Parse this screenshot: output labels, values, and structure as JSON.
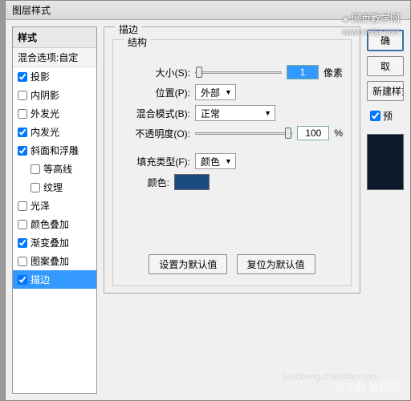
{
  "dialog_title": "图层样式",
  "watermark_top": "网页教学网",
  "watermark_top_url": "www.webjx.com",
  "watermark_bottom": "查字典 教程网",
  "watermark_bottom_url": "jiaocheng.chazidian.com",
  "left": {
    "header": "样式",
    "sub": "混合选项:自定",
    "items": [
      {
        "label": "投影",
        "checked": true
      },
      {
        "label": "内阴影",
        "checked": false
      },
      {
        "label": "外发光",
        "checked": false
      },
      {
        "label": "内发光",
        "checked": true
      },
      {
        "label": "斜面和浮雕",
        "checked": true
      },
      {
        "label": "等高线",
        "checked": false,
        "indent": true
      },
      {
        "label": "纹理",
        "checked": false,
        "indent": true
      },
      {
        "label": "光泽",
        "checked": false
      },
      {
        "label": "颜色叠加",
        "checked": false
      },
      {
        "label": "渐变叠加",
        "checked": true
      },
      {
        "label": "图案叠加",
        "checked": false
      },
      {
        "label": "描边",
        "checked": true,
        "selected": true
      }
    ]
  },
  "center": {
    "group_title": "描边",
    "struct_title": "结构",
    "size_label": "大小(S):",
    "size_value": "1",
    "size_unit": "像素",
    "position_label": "位置(P):",
    "position_value": "外部",
    "blend_label": "混合模式(B):",
    "blend_value": "正常",
    "opacity_label": "不透明度(O):",
    "opacity_value": "100",
    "opacity_unit": "%",
    "fill_type_label": "填充类型(F):",
    "fill_type_value": "颜色",
    "color_label": "颜色:",
    "color_value": "#1a4a80",
    "btn_default": "设置为默认值",
    "btn_reset": "复位为默认值"
  },
  "right": {
    "ok": "确",
    "cancel": "取",
    "new_style": "新建样式",
    "preview": "预"
  }
}
